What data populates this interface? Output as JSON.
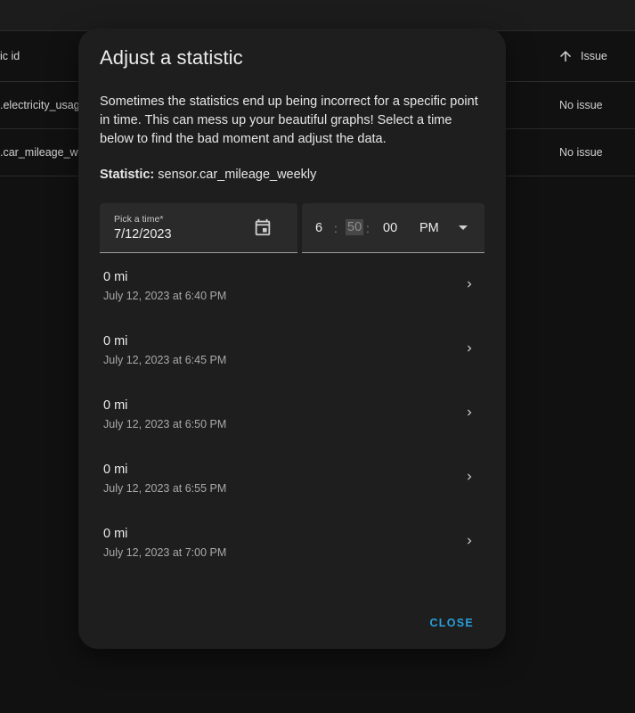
{
  "background": {
    "header_col_left": "ic id",
    "header_col_issue": "Issue",
    "rows": [
      {
        "id": ".electricity_usag",
        "issue": "No issue"
      },
      {
        "id": ".car_mileage_w",
        "issue": "No issue"
      }
    ]
  },
  "dialog": {
    "title": "Adjust a statistic",
    "description": "Sometimes the statistics end up being incorrect for a specific point in time. This can mess up your beautiful graphs! Select a time below to find the bad moment and adjust the data.",
    "statistic_label": "Statistic:",
    "statistic_value": "sensor.car_mileage_weekly",
    "date_field": {
      "label": "Pick a time*",
      "value": "7/12/2023",
      "icon": "calendar-icon"
    },
    "time_field": {
      "hour": "6",
      "minute": "50",
      "second": "00",
      "ampm": "PM",
      "separator": ":"
    },
    "entries": [
      {
        "value": "0 mi",
        "time": "July 12, 2023 at 6:40 PM"
      },
      {
        "value": "0 mi",
        "time": "July 12, 2023 at 6:45 PM"
      },
      {
        "value": "0 mi",
        "time": "July 12, 2023 at 6:50 PM"
      },
      {
        "value": "0 mi",
        "time": "July 12, 2023 at 6:55 PM"
      },
      {
        "value": "0 mi",
        "time": "July 12, 2023 at 7:00 PM"
      }
    ],
    "close_label": "CLOSE"
  },
  "colors": {
    "accent": "#2a9fd8",
    "dialog_bg": "#1e1e1f",
    "page_bg": "#111111"
  }
}
